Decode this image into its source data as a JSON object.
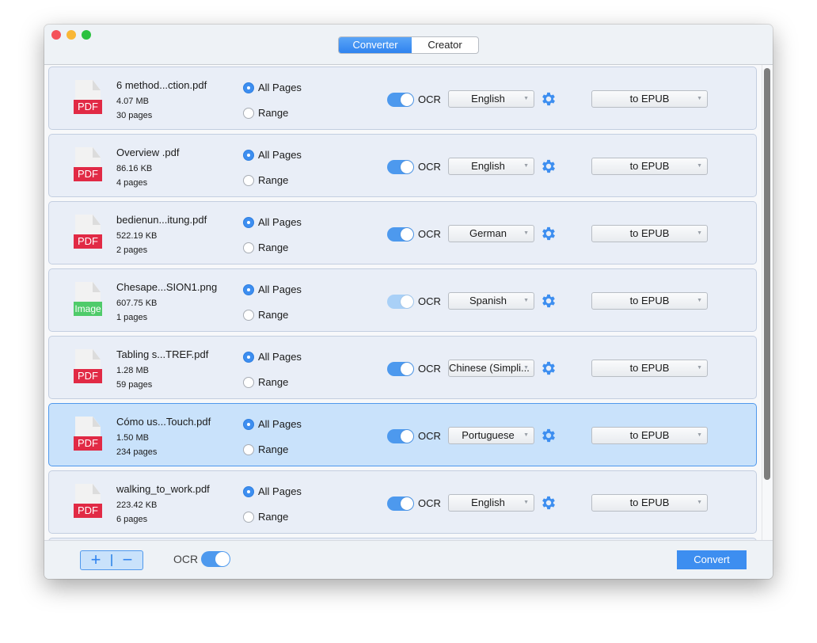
{
  "window": {
    "tabs": [
      {
        "label": "Converter",
        "active": true
      },
      {
        "label": "Creator",
        "active": false
      }
    ]
  },
  "files": [
    {
      "name": "6 method...ction.pdf",
      "size": "4.07 MB",
      "pages": "30 pages",
      "type_badge": "PDF",
      "type": "pdf",
      "page_option": "All Pages",
      "ocr": true,
      "ocr_enabled": true,
      "language": "English",
      "format": "to EPUB",
      "selected": false
    },
    {
      "name": "Overview .pdf",
      "size": "86.16 KB",
      "pages": "4 pages",
      "type_badge": "PDF",
      "type": "pdf",
      "page_option": "All Pages",
      "ocr": true,
      "ocr_enabled": true,
      "language": "English",
      "format": "to EPUB",
      "selected": false
    },
    {
      "name": "bedienun...itung.pdf",
      "size": "522.19 KB",
      "pages": "2 pages",
      "type_badge": "PDF",
      "type": "pdf",
      "page_option": "All Pages",
      "ocr": true,
      "ocr_enabled": true,
      "language": "German",
      "format": "to EPUB",
      "selected": false
    },
    {
      "name": "Chesape...SION1.png",
      "size": "607.75 KB",
      "pages": "1 pages",
      "type_badge": "Image",
      "type": "image",
      "page_option": "All Pages",
      "ocr": true,
      "ocr_enabled": false,
      "language": "Spanish",
      "format": "to EPUB",
      "selected": false
    },
    {
      "name": "Tabling s...TREF.pdf",
      "size": "1.28 MB",
      "pages": "59 pages",
      "type_badge": "PDF",
      "type": "pdf",
      "page_option": "All Pages",
      "ocr": true,
      "ocr_enabled": true,
      "language": "Chinese (Simpli...",
      "format": "to EPUB",
      "selected": false
    },
    {
      "name": "Cómo us...Touch.pdf",
      "size": "1.50 MB",
      "pages": "234 pages",
      "type_badge": "PDF",
      "type": "pdf",
      "page_option": "All Pages",
      "ocr": true,
      "ocr_enabled": true,
      "language": "Portuguese",
      "format": "to EPUB",
      "selected": true
    },
    {
      "name": "walking_to_work.pdf",
      "size": "223.42 KB",
      "pages": "6 pages",
      "type_badge": "PDF",
      "type": "pdf",
      "page_option": "All Pages",
      "ocr": true,
      "ocr_enabled": true,
      "language": "English",
      "format": "to EPUB",
      "selected": false
    }
  ],
  "labels": {
    "all_pages": "All Pages",
    "range": "Range",
    "ocr": "OCR"
  },
  "bottom": {
    "add_label": "+",
    "remove_label": "−",
    "ocr_label": "OCR",
    "ocr_on": true,
    "convert_label": "Convert"
  },
  "colors": {
    "accent": "#3d8ef0",
    "pdf_badge": "#e12a45",
    "image_badge": "#4fcb6a",
    "selected_row": "#c9e2fb"
  }
}
